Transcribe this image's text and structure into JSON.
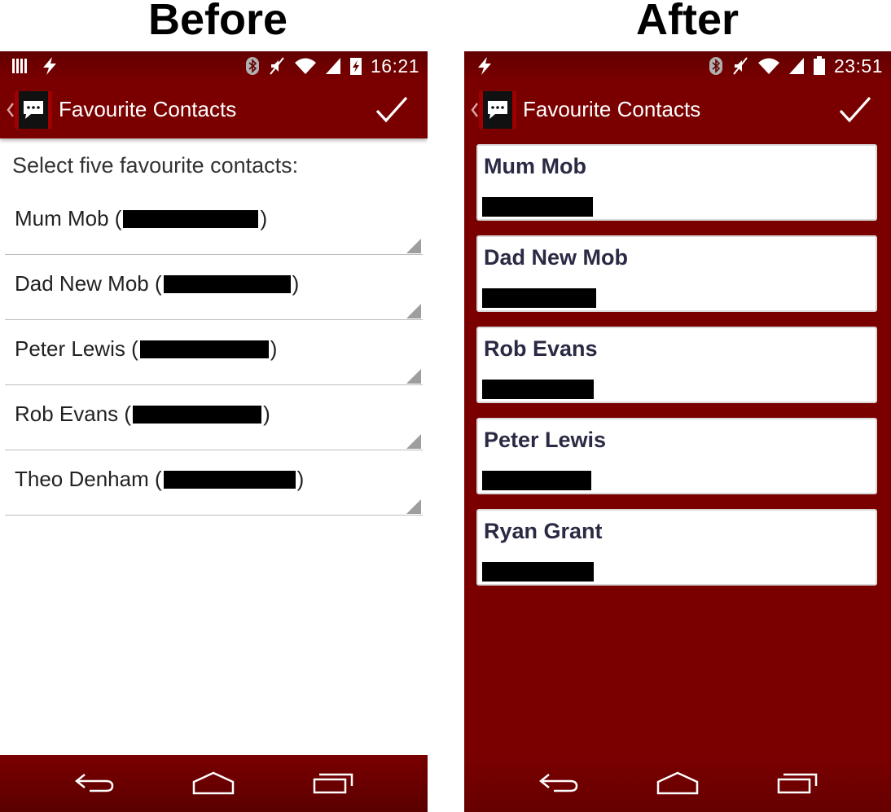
{
  "labels": {
    "before": "Before",
    "after": "After"
  },
  "colors": {
    "brand": "#7a0000",
    "card_name": "#2a2a44"
  },
  "before": {
    "status": {
      "time": "16:21",
      "icons": [
        "sim-icon",
        "charging-icon",
        "bluetooth-icon",
        "mute-icon",
        "wifi-icon",
        "signal-icon",
        "battery-charging-icon"
      ]
    },
    "app_bar": {
      "title": "Favourite Contacts",
      "confirm_icon": "check-icon"
    },
    "prompt": "Select five favourite contacts:",
    "contacts": [
      {
        "name": "Mum Mob",
        "number": "[redacted]"
      },
      {
        "name": "Dad New Mob",
        "number": "[redacted]"
      },
      {
        "name": "Peter Lewis",
        "number": "[redacted]"
      },
      {
        "name": "Rob Evans",
        "number": "[redacted]"
      },
      {
        "name": "Theo Denham",
        "number": "[redacted]"
      }
    ],
    "nav": [
      "back-icon",
      "home-icon",
      "recents-icon"
    ]
  },
  "after": {
    "status": {
      "time": "23:51",
      "icons": [
        "charging-icon",
        "bluetooth-icon",
        "mute-icon",
        "wifi-icon",
        "signal-icon",
        "battery-icon"
      ]
    },
    "app_bar": {
      "title": "Favourite Contacts",
      "confirm_icon": "check-icon"
    },
    "contacts": [
      {
        "name": "Mum Mob",
        "number": "[redacted]"
      },
      {
        "name": "Dad New Mob",
        "number": "[redacted]"
      },
      {
        "name": "Rob Evans",
        "number": "[redacted]"
      },
      {
        "name": "Peter Lewis",
        "number": "[redacted]"
      },
      {
        "name": "Ryan Grant",
        "number": "[redacted]"
      }
    ],
    "nav": [
      "back-icon",
      "home-icon",
      "recents-icon"
    ]
  }
}
